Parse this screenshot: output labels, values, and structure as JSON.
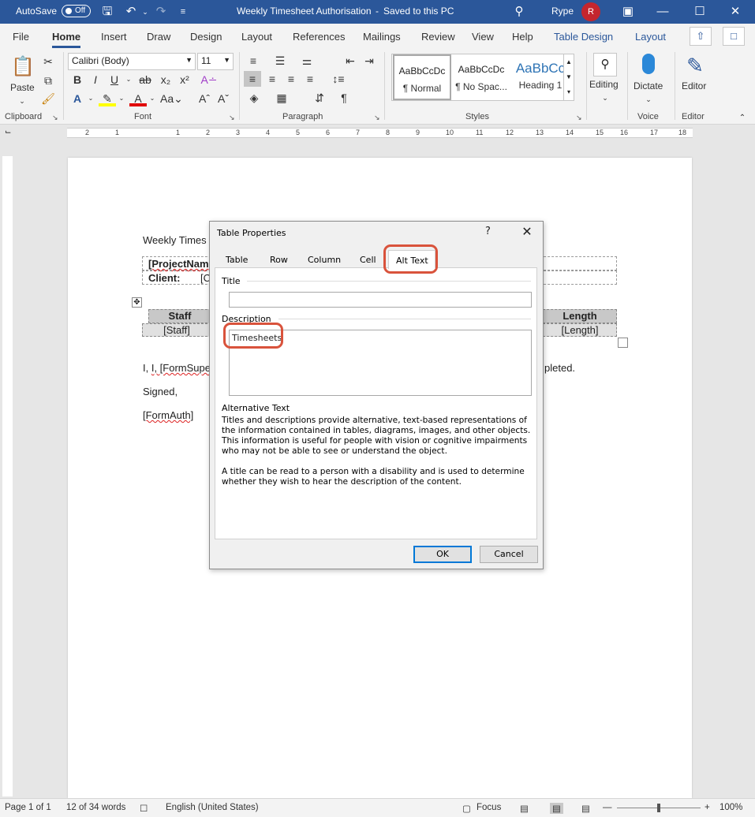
{
  "titlebar": {
    "autosave_label": "AutoSave",
    "autosave_state": "Off",
    "doc_title": "Weekly Timesheet Authorisation",
    "save_status": "Saved to this PC",
    "app_name": "Rype",
    "avatar_initial": "R"
  },
  "tabs": [
    "File",
    "Home",
    "Insert",
    "Draw",
    "Design",
    "Layout",
    "References",
    "Mailings",
    "Review",
    "View",
    "Help",
    "Table Design",
    "Layout"
  ],
  "active_tab": "Home",
  "ribbon": {
    "paste_label": "Paste",
    "font_name": "Calibri (Body)",
    "font_size": "11",
    "styles": [
      {
        "preview": "AaBbCcDc",
        "name": "¶ Normal"
      },
      {
        "preview": "AaBbCcDc",
        "name": "¶ No Spac..."
      },
      {
        "preview": "AaBbCc",
        "name": "Heading 1"
      }
    ],
    "editing_label": "Editing",
    "dictate_label": "Dictate",
    "editor_label": "Editor",
    "groups": {
      "clipboard": "Clipboard",
      "font": "Font",
      "paragraph": "Paragraph",
      "styles": "Styles",
      "voice": "Voice",
      "editor": "Editor"
    }
  },
  "ruler_numbers": [
    "2",
    "1",
    "1",
    "2",
    "3",
    "4",
    "5",
    "6",
    "7",
    "8",
    "9",
    "10",
    "11",
    "12",
    "13",
    "14",
    "15",
    "16",
    "17",
    "18"
  ],
  "document": {
    "heading": "Weekly Times",
    "project_name": "[ProjectNam",
    "client_label": "Client:",
    "client_value": "[C",
    "col_staff": "Staff",
    "col_length": "Length",
    "staff_value": "[Staff]",
    "length_value": "[Length]",
    "line1_start": "I, [FormSuperv",
    "line1_end": "pleted.",
    "signed": "Signed,",
    "form_auth": "[FormAuth]"
  },
  "dialog": {
    "title": "Table Properties",
    "help": "?",
    "tabs": [
      "Table",
      "Row",
      "Column",
      "Cell",
      "Alt Text"
    ],
    "active_tab": "Alt Text",
    "title_label": "Title",
    "title_value": "",
    "description_label": "Description",
    "description_value": "Timesheets",
    "alt_text_heading": "Alternative Text",
    "paragraph1": "Titles and descriptions provide alternative, text-based representations of the information contained in tables, diagrams, images, and other objects. This information is useful for people with vision or cognitive impairments who may not be able to see or understand the object.",
    "paragraph2": "A title can be read to a person with a disability and is used to determine whether they wish to hear the description of the content.",
    "ok_label": "OK",
    "cancel_label": "Cancel"
  },
  "status": {
    "page": "Page 1 of 1",
    "words": "12 of 34 words",
    "language": "English (United States)",
    "focus": "Focus",
    "zoom": "100%"
  },
  "colors": {
    "brand_blue": "#2b579a",
    "callout": "#d9533c",
    "avatar": "#c4262e"
  }
}
